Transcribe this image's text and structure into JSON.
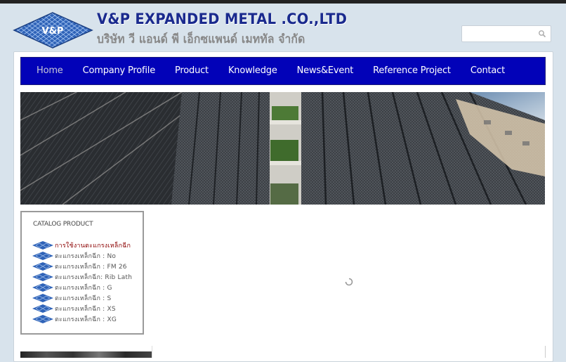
{
  "header": {
    "company_en": "V&P EXPANDED METAL .CO.,LTD",
    "company_th": "บริษัท วี แอนด์ พี เอ็กซแพนด์ เมททัล จำกัด",
    "logo_text": "V&P"
  },
  "search": {
    "placeholder": "",
    "icon": "search-icon"
  },
  "nav": {
    "items": [
      {
        "label": "Home",
        "active": true
      },
      {
        "label": "Company Profile"
      },
      {
        "label": "Product"
      },
      {
        "label": "Knowledge"
      },
      {
        "label": "News&Event"
      },
      {
        "label": "Reference Project"
      },
      {
        "label": "Contact"
      }
    ]
  },
  "catalog": {
    "title": "CATALOG PRODUCT",
    "items": [
      "การใช้งานตะแกรงเหล็กฉีก",
      "ตะแกรงเหล็กฉีก : No",
      "ตะแกรงเหล็กฉีก : FM 26",
      "ตะแกรงเหล็กฉีก: Rib Lath",
      "ตะแกรงเหล็กฉีก : G",
      "ตะแกรงเหล็กฉีก : S",
      "ตะแกรงเหล็กฉีก : XS",
      "ตะแกรงเหล็กฉีก : XG"
    ]
  },
  "colors": {
    "nav_bg": "#0202b8",
    "brand": "#1a2a8e",
    "logo_blue": "#2b5fb3"
  }
}
